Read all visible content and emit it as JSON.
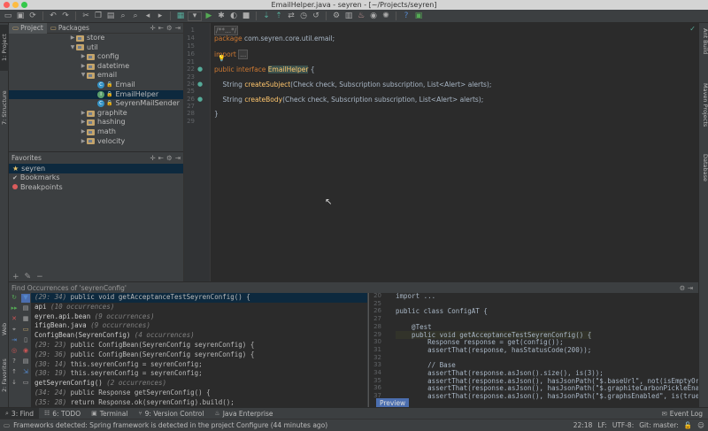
{
  "window": {
    "title": "EmailHelper.java - seyren - [~/Projects/seyren]",
    "traffic_colors": [
      "#fc605c",
      "#fdbc40",
      "#34c84a"
    ]
  },
  "left_strip": {
    "project_tab": "1: Project",
    "structure_tab": "7: Structure",
    "web_tab": "Web",
    "favorites_tab": "2: Favorites"
  },
  "right_strip": {
    "ant_tab": "Ant Build",
    "maven_tab": "Maven Projects",
    "database_tab": "Database"
  },
  "project_panel": {
    "tabs": [
      "Project",
      "Packages"
    ],
    "tree": [
      {
        "label": "store",
        "type": "folder",
        "depth": 2,
        "arrow": "right"
      },
      {
        "label": "util",
        "type": "folder",
        "depth": 2,
        "arrow": "down"
      },
      {
        "label": "config",
        "type": "folder",
        "depth": 3,
        "arrow": "right"
      },
      {
        "label": "datetime",
        "type": "folder",
        "depth": 3,
        "arrow": "right"
      },
      {
        "label": "email",
        "type": "folder",
        "depth": 3,
        "arrow": "down"
      },
      {
        "label": "Email",
        "type": "class",
        "depth": 4,
        "arrow": ""
      },
      {
        "label": "EmailHelper",
        "type": "interface",
        "depth": 4,
        "arrow": "",
        "selected": true
      },
      {
        "label": "SeyrenMailSender",
        "type": "class",
        "depth": 4,
        "arrow": ""
      },
      {
        "label": "graphite",
        "type": "folder",
        "depth": 3,
        "arrow": "right"
      },
      {
        "label": "hashing",
        "type": "folder",
        "depth": 3,
        "arrow": "right"
      },
      {
        "label": "math",
        "type": "folder",
        "depth": 3,
        "arrow": "right"
      },
      {
        "label": "velocity",
        "type": "folder",
        "depth": 3,
        "arrow": "right"
      }
    ]
  },
  "favorites_panel": {
    "title": "Favorites",
    "items": [
      {
        "label": "seyren",
        "icon": "star-icon",
        "selected": true
      },
      {
        "label": "Bookmarks",
        "icon": "check-icon",
        "selected": false
      },
      {
        "label": "Breakpoints",
        "icon": "breakpoint-icon",
        "selected": false
      }
    ]
  },
  "editor": {
    "lines": [
      {
        "n": "1",
        "html": "/**...*/",
        "cls": "cm"
      },
      {
        "n": "14",
        "html": "package com.seyren.core.util.email;"
      },
      {
        "n": "15",
        "html": ""
      },
      {
        "n": "16",
        "html": "import ..."
      },
      {
        "n": "21",
        "html": ""
      },
      {
        "n": "22",
        "html": "public interface EmailHelper {"
      },
      {
        "n": "23",
        "html": ""
      },
      {
        "n": "24",
        "html": "    String createSubject(Check check, Subscription subscription, List<Alert> alerts);"
      },
      {
        "n": "25",
        "html": ""
      },
      {
        "n": "26",
        "html": "    String createBody(Check check, Subscription subscription, List<Alert> alerts);"
      },
      {
        "n": "27",
        "html": ""
      },
      {
        "n": "28",
        "html": "}"
      },
      {
        "n": "29",
        "html": ""
      }
    ]
  },
  "find_panel": {
    "title": "Find Occurrences of 'seyrenConfig'",
    "rows": [
      {
        "loc": "(29: 34)",
        "text": " public void getAcceptanceTestSeyrenConfig() {",
        "selected": true
      },
      {
        "text": "api",
        "occ": " (10 occurrences)"
      },
      {
        "text": "eyren.api.bean",
        "occ": " (9 occurrences)"
      },
      {
        "text": "ifigBean.java",
        "occ": " (9 occurrences)"
      },
      {
        "text": "ConfigBean(SeyrenConfig)",
        "occ": " (4 occurrences)"
      },
      {
        "loc": "(29: 23)",
        "text": " public ConfigBean(SeyrenConfig seyrenConfig) {"
      },
      {
        "loc": "(29: 36)",
        "text": " public ConfigBean(SeyrenConfig seyrenConfig) {"
      },
      {
        "loc": "(30: 14)",
        "text": " this.seyrenConfig = seyrenConfig;"
      },
      {
        "loc": "(30: 19)",
        "text": " this.seyrenConfig = seyrenConfig;"
      },
      {
        "text": "getSeyrenConfig()",
        "occ": " (2 occurrences)"
      },
      {
        "loc": "(34: 24)",
        "text": " public Response getSeyrenConfig() {"
      },
      {
        "loc": "(35: 28)",
        "text": " return Response.ok(seyrenConfig).build();"
      }
    ],
    "preview": [
      {
        "n": "20",
        "text": "import ..."
      },
      {
        "n": "25",
        "text": ""
      },
      {
        "n": "26",
        "text": "public class ConfigAT {"
      },
      {
        "n": "27",
        "text": ""
      },
      {
        "n": "28",
        "text": "    @Test"
      },
      {
        "n": "29",
        "text": "    public void getAcceptanceTestSeyrenConfig() {"
      },
      {
        "n": "30",
        "text": "        Response response = get(config());"
      },
      {
        "n": "31",
        "text": "        assertThat(response, hasStatusCode(200));"
      },
      {
        "n": "32",
        "text": ""
      },
      {
        "n": "33",
        "text": "        // Base"
      },
      {
        "n": "34",
        "text": "        assertThat(response.asJson().size(), is(3));"
      },
      {
        "n": "35",
        "text": "        assertThat(response.asJson(), hasJsonPath(\"$.baseUrl\", not(isEmptyOrNullString())));"
      },
      {
        "n": "36",
        "text": "        assertThat(response.asJson(), hasJsonPath(\"$.graphiteCarbonPickleEnabled\", is(false)"
      },
      {
        "n": "37",
        "text": "        assertThat(response.asJson(), hasJsonPath(\"$.graphsEnabled\", is(true)));"
      }
    ],
    "preview_tab": "Preview"
  },
  "bottom_tabs": [
    {
      "label": "3: Find",
      "icon": "search-icon",
      "active": true
    },
    {
      "label": "6: TODO",
      "icon": "todo-icon"
    },
    {
      "label": "Terminal",
      "icon": "terminal-icon"
    },
    {
      "label": "9: Version Control",
      "icon": "vcs-icon"
    },
    {
      "label": "Java Enterprise",
      "icon": "java-ee-icon"
    }
  ],
  "event_log": "Event Log",
  "status": {
    "message": "Frameworks detected: Spring framework is detected in the project Configure (44 minutes ago)",
    "position": "22:18",
    "line_sep": "LF:",
    "encoding": "UTF-8:",
    "git": "Git: master:"
  }
}
